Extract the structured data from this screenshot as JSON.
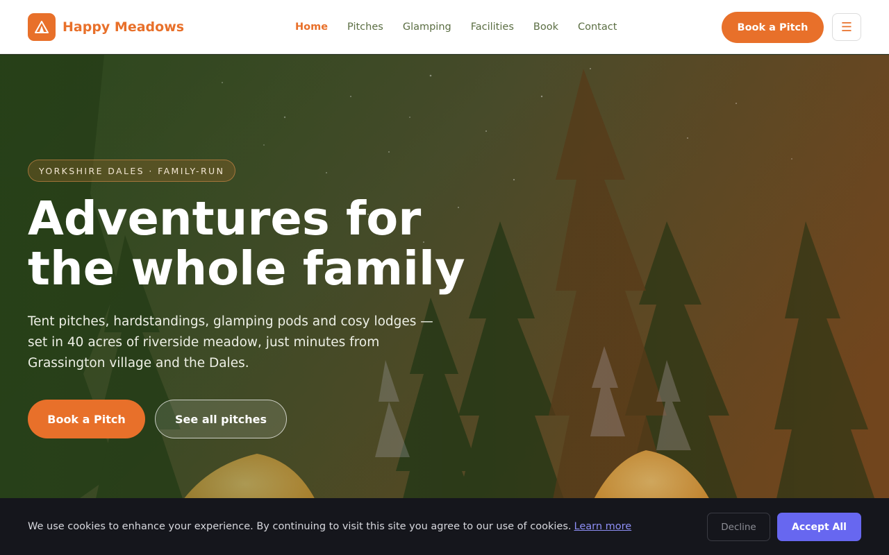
{
  "brand": {
    "name": "Happy Meadows",
    "accent": "#e8702a",
    "logo_icon": "tent-icon"
  },
  "nav": {
    "items": [
      {
        "label": "Home",
        "active": true
      },
      {
        "label": "Pitches",
        "active": false
      },
      {
        "label": "Glamping",
        "active": false
      },
      {
        "label": "Facilities",
        "active": false
      },
      {
        "label": "Book",
        "active": false
      },
      {
        "label": "Contact",
        "active": false
      }
    ]
  },
  "header": {
    "cta_label": "Book a Pitch",
    "menu_icon": "hamburger-menu-icon",
    "menu_glyph": "☰"
  },
  "hero": {
    "badge": "YORKSHIRE DALES · FAMILY-RUN",
    "title_line1": "Adventures for",
    "title_line2": "the whole family",
    "subtitle": "Tent pitches, hardstandings, glamping pods and cosy lodges — set in 40 acres of riverside meadow, just minutes from Grassington village and the Dales.",
    "primary_cta": "Book a Pitch",
    "secondary_cta": "See all pitches"
  },
  "cookie": {
    "text": "We use cookies to enhance your experience. By continuing to visit this site you agree to our use of cookies.",
    "link": "Learn more",
    "decline": "Decline",
    "accept": "Accept All",
    "accept_color": "#6767f0"
  }
}
